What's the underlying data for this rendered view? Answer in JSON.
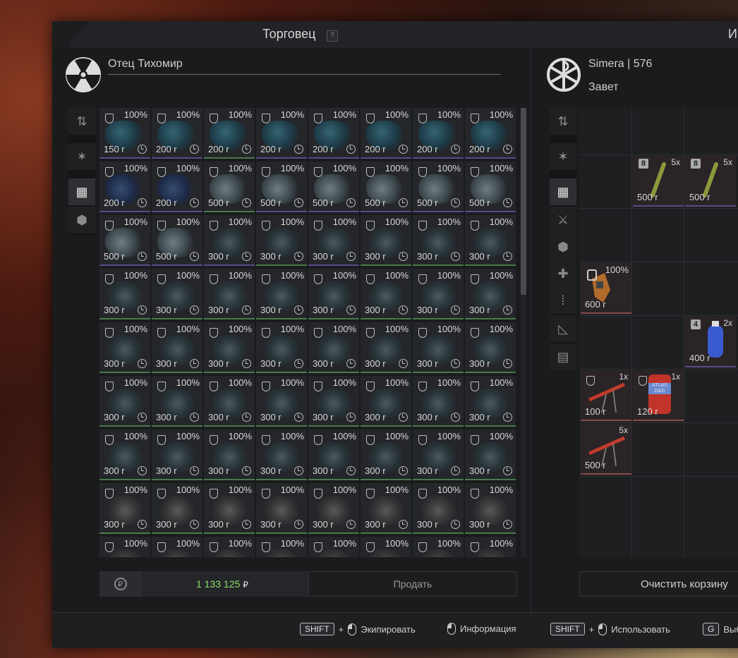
{
  "header": {
    "trader_title": "Торговец",
    "help": "?",
    "right_title": "И"
  },
  "trader": {
    "name": "Отец Тихомир"
  },
  "player": {
    "name": "Simera | 576",
    "faction": "Завет"
  },
  "left_sidebar": {
    "icons": [
      "sort-icon",
      "star-icon",
      "grid-icon",
      "artifact-icon"
    ],
    "active": 2
  },
  "right_sidebar": {
    "icons": [
      "sort-icon",
      "star-icon",
      "grid-icon",
      "weapon-icon",
      "artifact-icon",
      "medkit-icon",
      "ammo-icon",
      "tools-icon",
      "container-icon"
    ],
    "active": 2
  },
  "trader_items": [
    {
      "pct": "100%",
      "price": "150 r",
      "art": "teal",
      "b": "purple"
    },
    {
      "pct": "100%",
      "price": "200 r",
      "art": "teal",
      "b": "purple"
    },
    {
      "pct": "100%",
      "price": "200 r",
      "art": "teal",
      "b": "green"
    },
    {
      "pct": "100%",
      "price": "200 r",
      "art": "teal",
      "b": "purple"
    },
    {
      "pct": "100%",
      "price": "200 r",
      "art": "teal",
      "b": "purple"
    },
    {
      "pct": "100%",
      "price": "200 r",
      "art": "teal",
      "b": "purple"
    },
    {
      "pct": "100%",
      "price": "200 r",
      "art": "teal",
      "b": "purple"
    },
    {
      "pct": "100%",
      "price": "200 r",
      "art": "teal",
      "b": "purple"
    },
    {
      "pct": "100%",
      "price": "200 r",
      "art": "blue",
      "b": "purple"
    },
    {
      "pct": "100%",
      "price": "200 r",
      "art": "blue",
      "b": "purple"
    },
    {
      "pct": "100%",
      "price": "500 r",
      "art": "grey",
      "b": "green"
    },
    {
      "pct": "100%",
      "price": "500 r",
      "art": "grey",
      "b": "purple"
    },
    {
      "pct": "100%",
      "price": "500 r",
      "art": "grey",
      "b": "purple"
    },
    {
      "pct": "100%",
      "price": "500 r",
      "art": "grey",
      "b": "purple"
    },
    {
      "pct": "100%",
      "price": "500 r",
      "art": "grey",
      "b": "purple"
    },
    {
      "pct": "100%",
      "price": "500 r",
      "art": "grey",
      "b": "purple"
    },
    {
      "pct": "100%",
      "price": "500 r",
      "art": "grey",
      "b": "purple"
    },
    {
      "pct": "100%",
      "price": "500 r",
      "art": "grey",
      "b": "purple"
    },
    {
      "pct": "100%",
      "price": "300 r",
      "art": "dark",
      "b": "purple"
    },
    {
      "pct": "100%",
      "price": "300 r",
      "art": "dark",
      "b": "green"
    },
    {
      "pct": "100%",
      "price": "300 r",
      "art": "dark",
      "b": "purple"
    },
    {
      "pct": "100%",
      "price": "300 r",
      "art": "dark",
      "b": "green"
    },
    {
      "pct": "100%",
      "price": "300 r",
      "art": "dark",
      "b": "green"
    },
    {
      "pct": "100%",
      "price": "300 r",
      "art": "dark",
      "b": "green"
    },
    {
      "pct": "100%",
      "price": "300 r",
      "art": "dark",
      "b": "green"
    },
    {
      "pct": "100%",
      "price": "300 r",
      "art": "dark",
      "b": "green"
    },
    {
      "pct": "100%",
      "price": "300 r",
      "art": "dark",
      "b": "green"
    },
    {
      "pct": "100%",
      "price": "300 r",
      "art": "dark",
      "b": "green"
    },
    {
      "pct": "100%",
      "price": "300 r",
      "art": "dark",
      "b": "green"
    },
    {
      "pct": "100%",
      "price": "300 r",
      "art": "dark",
      "b": "green"
    },
    {
      "pct": "100%",
      "price": "300 r",
      "art": "dark",
      "b": "green"
    },
    {
      "pct": "100%",
      "price": "300 r",
      "art": "dark",
      "b": "green"
    },
    {
      "pct": "100%",
      "price": "300 r",
      "art": "dark",
      "b": "green"
    },
    {
      "pct": "100%",
      "price": "300 r",
      "art": "dark",
      "b": "green"
    },
    {
      "pct": "100%",
      "price": "300 r",
      "art": "dark",
      "b": "green"
    },
    {
      "pct": "100%",
      "price": "300 r",
      "art": "dark",
      "b": "green"
    },
    {
      "pct": "100%",
      "price": "300 r",
      "art": "dark",
      "b": "green"
    },
    {
      "pct": "100%",
      "price": "300 r",
      "art": "dark",
      "b": "green"
    },
    {
      "pct": "100%",
      "price": "300 r",
      "art": "dark",
      "b": "green"
    },
    {
      "pct": "100%",
      "price": "300 r",
      "art": "dark",
      "b": "green"
    },
    {
      "pct": "100%",
      "price": "300 r",
      "art": "dark",
      "b": "green"
    },
    {
      "pct": "100%",
      "price": "300 r",
      "art": "dark",
      "b": "green"
    },
    {
      "pct": "100%",
      "price": "300 r",
      "art": "dark",
      "b": "green"
    },
    {
      "pct": "100%",
      "price": "300 r",
      "art": "dark",
      "b": "green"
    },
    {
      "pct": "100%",
      "price": "300 r",
      "art": "dark",
      "b": "green"
    },
    {
      "pct": "100%",
      "price": "300 r",
      "art": "dark",
      "b": "green"
    },
    {
      "pct": "100%",
      "price": "300 r",
      "art": "dark",
      "b": "green"
    },
    {
      "pct": "100%",
      "price": "300 r",
      "art": "dark",
      "b": "green"
    },
    {
      "pct": "100%",
      "price": "300 r",
      "art": "dark",
      "b": "green"
    },
    {
      "pct": "100%",
      "price": "300 r",
      "art": "dark",
      "b": "green"
    },
    {
      "pct": "100%",
      "price": "300 r",
      "art": "dark",
      "b": "green"
    },
    {
      "pct": "100%",
      "price": "300 r",
      "art": "dark",
      "b": "green"
    },
    {
      "pct": "100%",
      "price": "300 r",
      "art": "dark",
      "b": "green"
    },
    {
      "pct": "100%",
      "price": "300 r",
      "art": "dark",
      "b": "green"
    },
    {
      "pct": "100%",
      "price": "300 r",
      "art": "dark",
      "b": "green"
    },
    {
      "pct": "100%",
      "price": "300 r",
      "art": "dark",
      "b": "green"
    },
    {
      "pct": "100%",
      "price": "300 r",
      "art": "darkgrey",
      "b": "green"
    },
    {
      "pct": "100%",
      "price": "300 r",
      "art": "darkgrey",
      "b": "green"
    },
    {
      "pct": "100%",
      "price": "300 r",
      "art": "darkgrey",
      "b": "green"
    },
    {
      "pct": "100%",
      "price": "300 r",
      "art": "darkgrey",
      "b": "green"
    },
    {
      "pct": "100%",
      "price": "300 r",
      "art": "darkgrey",
      "b": "green"
    },
    {
      "pct": "100%",
      "price": "300 r",
      "art": "darkgrey",
      "b": "green"
    },
    {
      "pct": "100%",
      "price": "300 r",
      "art": "darkgrey",
      "b": "green"
    },
    {
      "pct": "100%",
      "price": "300 r",
      "art": "darkgrey",
      "b": "green"
    },
    {
      "pct": "100%",
      "price": "",
      "art": "darkgrey",
      "b": "green"
    },
    {
      "pct": "100%",
      "price": "",
      "art": "darkgrey",
      "b": "green"
    },
    {
      "pct": "100%",
      "price": "",
      "art": "darkgrey",
      "b": "green"
    },
    {
      "pct": "100%",
      "price": "",
      "art": "darkgrey",
      "b": "green"
    },
    {
      "pct": "100%",
      "price": "",
      "art": "darkgrey",
      "b": "green"
    },
    {
      "pct": "100%",
      "price": "",
      "art": "darkgrey",
      "b": "green"
    },
    {
      "pct": "100%",
      "price": "",
      "art": "darkgrey",
      "b": "green"
    },
    {
      "pct": "100%",
      "price": "",
      "art": "darkgrey",
      "b": "green"
    }
  ],
  "inventory_items": [
    {
      "id": "syringe-1",
      "tier": "8",
      "qty": "5x",
      "price": "500 r",
      "kind": "syringe"
    },
    {
      "id": "syringe-2",
      "tier": "8",
      "qty": "5x",
      "price": "500 r",
      "kind": "syringe"
    },
    {
      "id": "detector",
      "pct": "100%",
      "price": "600 r",
      "kind": "detector"
    },
    {
      "id": "spray-can",
      "tier": "4",
      "qty": "2x",
      "price": "400 r",
      "kind": "spray"
    },
    {
      "id": "slingshot",
      "qty": "1x",
      "price": "100 r",
      "kind": "weapon"
    },
    {
      "id": "atlas-can",
      "qty": "1x",
      "price": "120 r",
      "kind": "can",
      "can_text": "ATLAS D&G"
    },
    {
      "id": "slingshot-2",
      "qty": "5x",
      "price": "500 r",
      "kind": "weapon"
    }
  ],
  "bottom": {
    "money": "1 133 125",
    "currency": "₽",
    "sell_label": "Продать",
    "clear_label": "Очистить корзину"
  },
  "footer": {
    "equip_key": "SHIFT",
    "equip_plus": "+",
    "equip_label": "Экипировать",
    "info_label": "Информация",
    "use_key": "SHIFT",
    "use_plus": "+",
    "use_label": "Использовать",
    "g_key": "G",
    "g_label": "Выб"
  },
  "colors": {
    "money": "#8adf6a",
    "border_purple": "#5a4a8a",
    "border_green": "#4a7a4a"
  }
}
